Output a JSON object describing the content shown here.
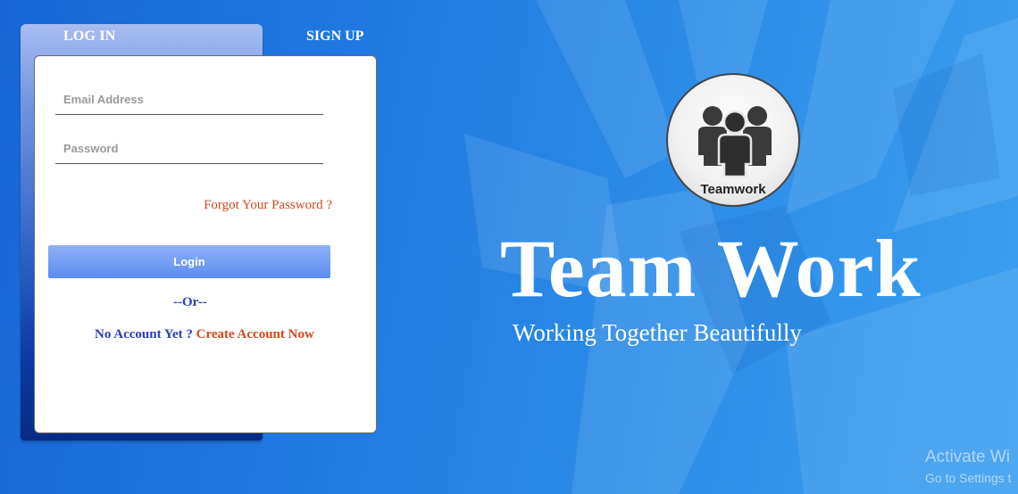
{
  "tabs": {
    "login": "LOG IN",
    "signup": "SIGN UP"
  },
  "form": {
    "email_placeholder": "Email Address",
    "password_placeholder": "Password",
    "forgot": "Forgot Your Password ?",
    "login_button": "Login",
    "or_text": "--Or--",
    "no_account": "No Account Yet ?",
    "create_account": "Create Account Now"
  },
  "hero": {
    "logo_caption": "Teamwork",
    "title": "Team Work",
    "subtitle": "Working Together Beautifully"
  },
  "watermark": {
    "line1": "Activate Wi",
    "line2": "Go to Settings t"
  },
  "colors": {
    "accent_orange": "#d2471a",
    "link_blue": "#2a3fb8",
    "button_blue": "#5b8cf0"
  },
  "icons": {
    "logo": "people-group-icon"
  }
}
